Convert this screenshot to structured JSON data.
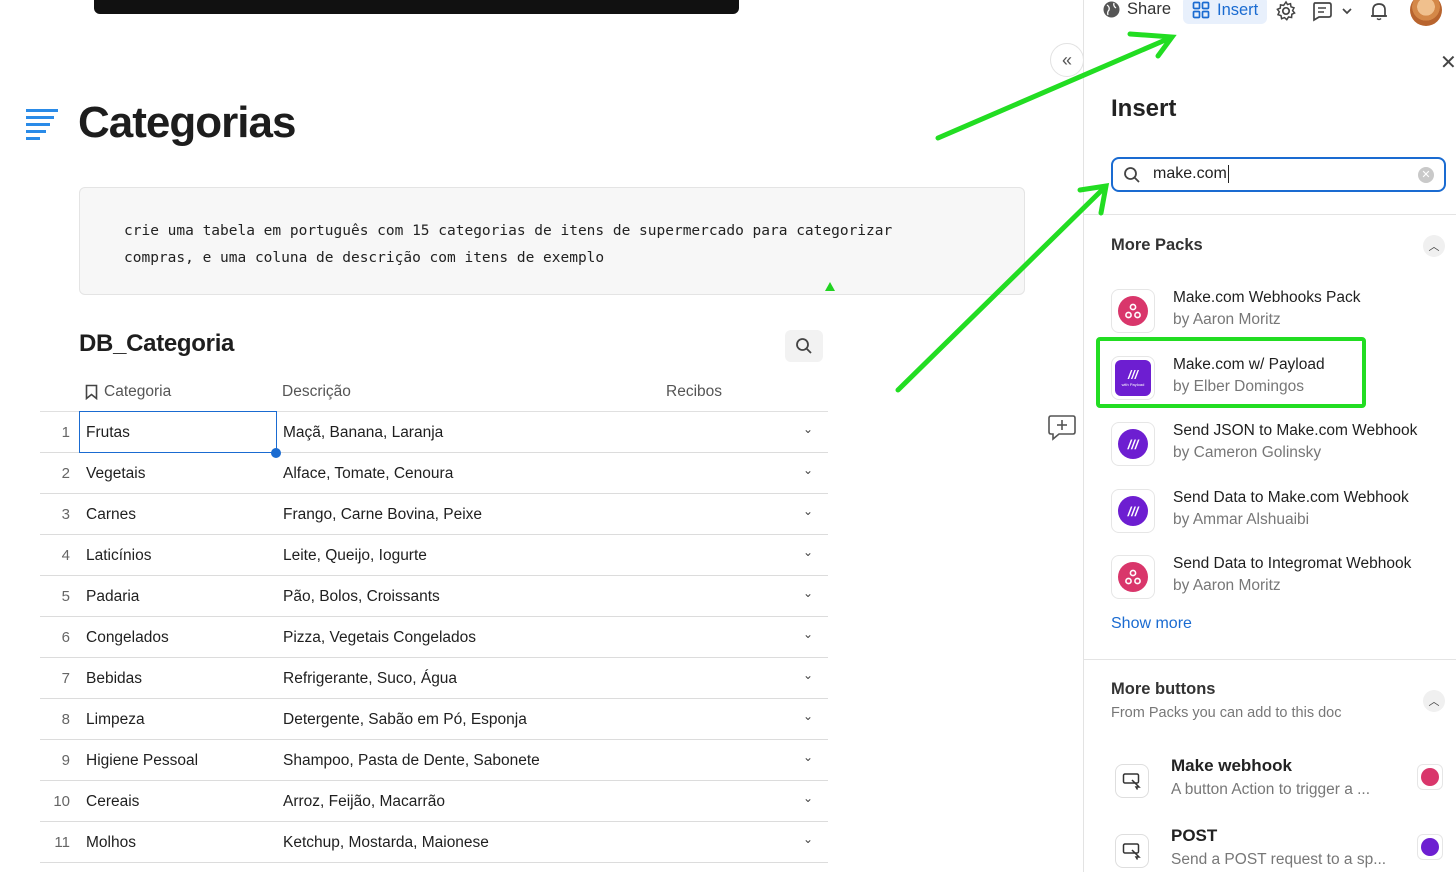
{
  "page": {
    "title": "Categorias",
    "ai_prompt_line1": "crie uma tabela em português com 15 categorias de itens de supermercado para categorizar",
    "ai_prompt_line2": "compras, e uma coluna de descrição com itens de exemplo"
  },
  "table": {
    "title": "DB_Categoria",
    "columns": [
      "Categoria",
      "Descrição",
      "Recibos"
    ],
    "rows": [
      {
        "n": "1",
        "categoria": "Frutas",
        "descricao": "Maçã, Banana, Laranja"
      },
      {
        "n": "2",
        "categoria": "Vegetais",
        "descricao": "Alface, Tomate, Cenoura"
      },
      {
        "n": "3",
        "categoria": "Carnes",
        "descricao": "Frango, Carne Bovina, Peixe"
      },
      {
        "n": "4",
        "categoria": "Laticínios",
        "descricao": "Leite, Queijo, Iogurte"
      },
      {
        "n": "5",
        "categoria": "Padaria",
        "descricao": "Pão, Bolos, Croissants"
      },
      {
        "n": "6",
        "categoria": "Congelados",
        "descricao": "Pizza, Vegetais Congelados"
      },
      {
        "n": "7",
        "categoria": "Bebidas",
        "descricao": "Refrigerante, Suco, Água"
      },
      {
        "n": "8",
        "categoria": "Limpeza",
        "descricao": "Detergente, Sabão em Pó, Esponja"
      },
      {
        "n": "9",
        "categoria": "Higiene Pessoal",
        "descricao": "Shampoo, Pasta de Dente, Sabonete"
      },
      {
        "n": "10",
        "categoria": "Cereais",
        "descricao": "Arroz, Feijão, Macarrão"
      },
      {
        "n": "11",
        "categoria": "Molhos",
        "descricao": "Ketchup, Mostarda, Maionese"
      }
    ]
  },
  "topnav": {
    "share_label": "Share",
    "insert_label": "Insert"
  },
  "panel": {
    "title": "Insert",
    "search_value": "make.com",
    "more_packs_title": "More Packs",
    "packs": [
      {
        "name": "Make.com Webhooks Pack",
        "by": "by Aaron Moritz",
        "logo": "webhook-icon"
      },
      {
        "name": "Make.com w/ Payload",
        "by": "by Elber Domingos",
        "logo": "make-payload-logo"
      },
      {
        "name": "Send JSON to Make.com Webhook",
        "by": "by Cameron Golinsky",
        "logo": "make-logo"
      },
      {
        "name": "Send Data to Make.com Webhook",
        "by": "by Ammar Alshuaibi",
        "logo": "make-logo"
      },
      {
        "name": "Send Data to Integromat Webhook",
        "by": "by Aaron Moritz",
        "logo": "webhook-icon"
      }
    ],
    "show_more": "Show more",
    "more_buttons_title": "More buttons",
    "more_buttons_sub": "From Packs you can add to this doc",
    "buttons": [
      {
        "name": "Make webhook",
        "desc": "A button Action to trigger a ..."
      },
      {
        "name": "POST",
        "desc": "Send a POST request to a sp..."
      }
    ]
  },
  "colors": {
    "accent": "#1a6bd1",
    "annotation": "#22dd22",
    "make_purple": "#6d1ed1",
    "webhook_pink": "#d9366b"
  }
}
